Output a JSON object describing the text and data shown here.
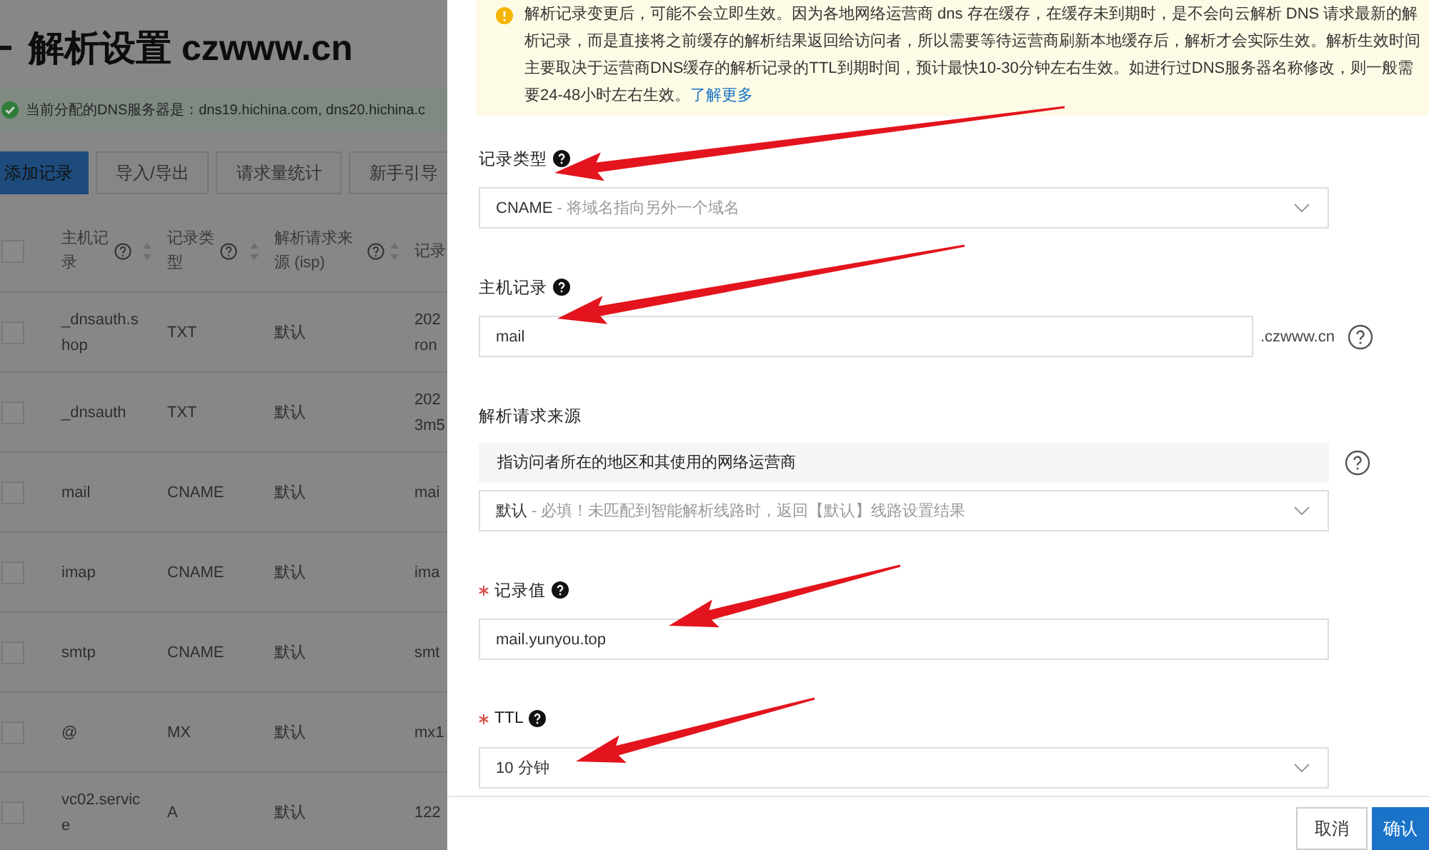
{
  "page": {
    "title": "解析设置 czwww.cn",
    "dns_notice": "当前分配的DNS服务器是：dns19.hichina.com, dns20.hichina.c",
    "toolbar": [
      {
        "label": "添加记录",
        "kind": "primary"
      },
      {
        "label": "导入/导出",
        "kind": "default"
      },
      {
        "label": "请求量统计",
        "kind": "default"
      },
      {
        "label": "新手引导",
        "kind": "default"
      }
    ],
    "table": {
      "header_checked": false,
      "columns": [
        {
          "label": "主机记录",
          "help": true,
          "sortable": true
        },
        {
          "label": "记录类型",
          "help": true,
          "sortable": true
        },
        {
          "label": "解析请求来源 (isp)",
          "help": true,
          "sortable": true
        },
        {
          "label": "记录",
          "help": false,
          "sortable": false
        }
      ],
      "rows": [
        {
          "host": "_dnsauth.shop",
          "type": "TXT",
          "line": "默认",
          "value": "202 ron",
          "checked": false
        },
        {
          "host": "_dnsauth",
          "type": "TXT",
          "line": "默认",
          "value": "202 3m5",
          "checked": false
        },
        {
          "host": "mail",
          "type": "CNAME",
          "line": "默认",
          "value": "mai",
          "checked": false
        },
        {
          "host": "imap",
          "type": "CNAME",
          "line": "默认",
          "value": "ima",
          "checked": false
        },
        {
          "host": "smtp",
          "type": "CNAME",
          "line": "默认",
          "value": "smt",
          "checked": false
        },
        {
          "host": "@",
          "type": "MX",
          "line": "默认",
          "value": "mx1",
          "checked": false
        },
        {
          "host": "vc02.service",
          "type": "A",
          "line": "默认",
          "value": "122",
          "checked": false
        }
      ]
    }
  },
  "drawer": {
    "notice": {
      "text": "解析记录变更后，可能不会立即生效。因为各地网络运营商 dns 存在缓存，在缓存未到期时，是不会向云解析 DNS 请求最新的解析记录，而是直接将之前缓存的解析结果返回给访问者，所以需要等待运营商刷新本地缓存后，解析才会实际生效。解析生效时间主要取决于运营商DNS缓存的解析记录的TTL到期时间，预计最快10-30分钟左右生效。如进行过DNS服务器名称修改，则一般需要24-48小时左右生效。",
      "link": "了解更多"
    },
    "fields": [
      {
        "kind": "select",
        "label": "记录类型",
        "required": false,
        "help": true,
        "value": "CNAME",
        "hint": "- 将域名指向另外一个域名"
      },
      {
        "kind": "input",
        "label": "主机记录",
        "required": false,
        "help": true,
        "value": "mail",
        "suffix": ".czwww.cn"
      },
      {
        "kind": "line",
        "label": "解析请求来源",
        "required": false,
        "help": false,
        "info": "指访问者所在的地区和其使用的网络运营商",
        "value": "默认",
        "hint": "- 必填！未匹配到智能解析线路时，返回【默认】线路设置结果"
      },
      {
        "kind": "input",
        "label": "记录值",
        "required": true,
        "help": true,
        "value": "mail.yunyou.top"
      },
      {
        "kind": "select",
        "label": "TTL",
        "required": true,
        "help": true,
        "value": "10 分钟"
      }
    ],
    "buttons": [
      {
        "label": "取消",
        "kind": "default"
      },
      {
        "label": "确认",
        "kind": "primary"
      }
    ]
  }
}
